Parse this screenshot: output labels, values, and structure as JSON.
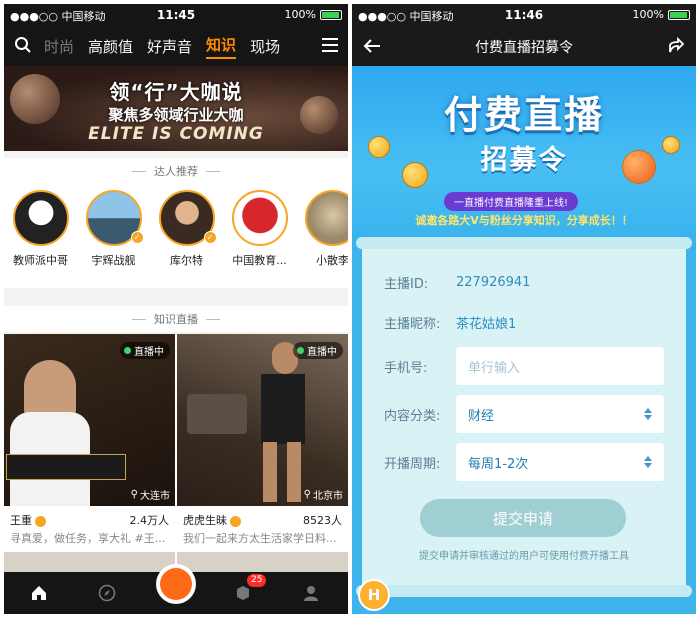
{
  "left": {
    "status": {
      "carrier": "●●●○○ 中国移动",
      "time": "11:45",
      "battery": "100%"
    },
    "nav": {
      "tabs": [
        {
          "label": "时尚",
          "state": "faded"
        },
        {
          "label": "高颜值",
          "state": "normal"
        },
        {
          "label": "好声音",
          "state": "normal"
        },
        {
          "label": "知识",
          "state": "active"
        },
        {
          "label": "现场",
          "state": "normal"
        }
      ]
    },
    "banner": {
      "line1": "领“行”大咖说",
      "line2": "聚焦多领域行业大咖",
      "line3": "ELITE IS COMING"
    },
    "talents_header": "达人推荐",
    "talents": [
      {
        "name": "教师派中哥",
        "verified": false
      },
      {
        "name": "宇辉战舰",
        "verified": true
      },
      {
        "name": "库尔特",
        "verified": true
      },
      {
        "name": "中国教育...",
        "verified": false
      },
      {
        "name": "小散李",
        "verified": false
      }
    ],
    "live_header": "知识直播",
    "cards": [
      {
        "live_label": "直播中",
        "location": "大连市",
        "name": "王重",
        "count": "2.4万人",
        "desc": "寻真爱，做任务，享大礼 #王..."
      },
      {
        "live_label": "直播中",
        "location": "北京市",
        "name": "虎虎生昧",
        "count": "8523人",
        "desc": "我们一起来方太生活家学日料..."
      }
    ],
    "tabbar": {
      "message_badge": "25"
    }
  },
  "right": {
    "status": {
      "carrier": "●●●○○ 中国移动",
      "time": "11:46",
      "battery": "100%"
    },
    "nav": {
      "title": "付费直播招募令"
    },
    "hero": {
      "title": "付费直播",
      "subtitle": "招募令",
      "pill": "一直播付费直播隆重上线!",
      "tagline": "诚邀各路大V与粉丝分享知识，分享成长！！"
    },
    "form": {
      "anchor_id_label": "主播ID:",
      "anchor_id_value": "227926941",
      "nickname_label": "主播昵称:",
      "nickname_value": "茶花姑娘1",
      "phone_label": "手机号:",
      "phone_placeholder": "单行输入",
      "category_label": "内容分类:",
      "category_value": "财经",
      "period_label": "开播周期:",
      "period_value": "每周1-2次",
      "submit_label": "提交申请",
      "note": "提交申请并审核通过的用户可使用付费开播工具"
    },
    "float_logo": "H"
  }
}
